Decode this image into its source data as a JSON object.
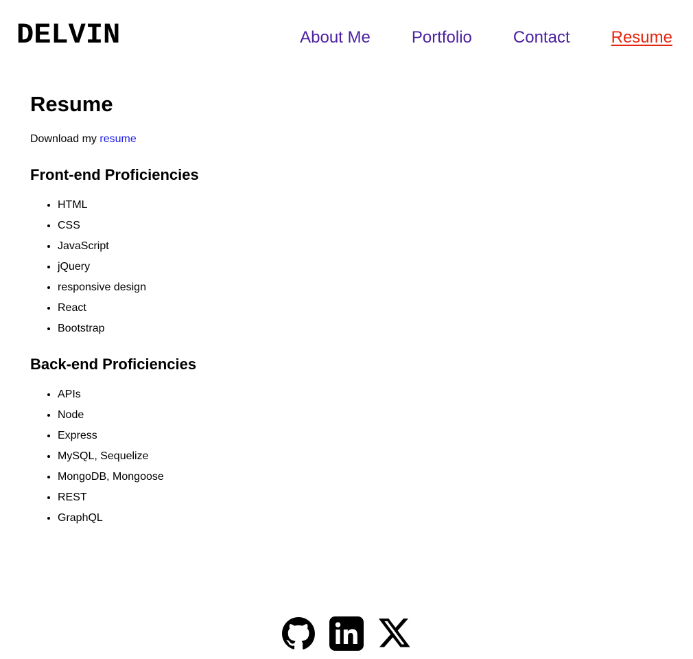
{
  "header": {
    "logo": "DELVIN",
    "nav": [
      {
        "label": "About Me",
        "active": false
      },
      {
        "label": "Portfolio",
        "active": false
      },
      {
        "label": "Contact",
        "active": false
      },
      {
        "label": "Resume",
        "active": true
      }
    ]
  },
  "main": {
    "title": "Resume",
    "download_prefix": "Download my ",
    "download_link": "resume",
    "sections": [
      {
        "heading": "Front-end Proficiencies",
        "items": [
          "HTML",
          "CSS",
          "JavaScript",
          "jQuery",
          "responsive design",
          "React",
          "Bootstrap"
        ]
      },
      {
        "heading": "Back-end Proficiencies",
        "items": [
          "APIs",
          "Node",
          "Express",
          "MySQL, Sequelize",
          "MongoDB, Mongoose",
          "REST",
          "GraphQL"
        ]
      }
    ]
  },
  "footer": {
    "icons": [
      "github-icon",
      "linkedin-icon",
      "x-twitter-icon"
    ]
  },
  "colors": {
    "nav_link": "#4a1fa0",
    "nav_active": "#e5260e",
    "link": "#1a1ae6"
  }
}
